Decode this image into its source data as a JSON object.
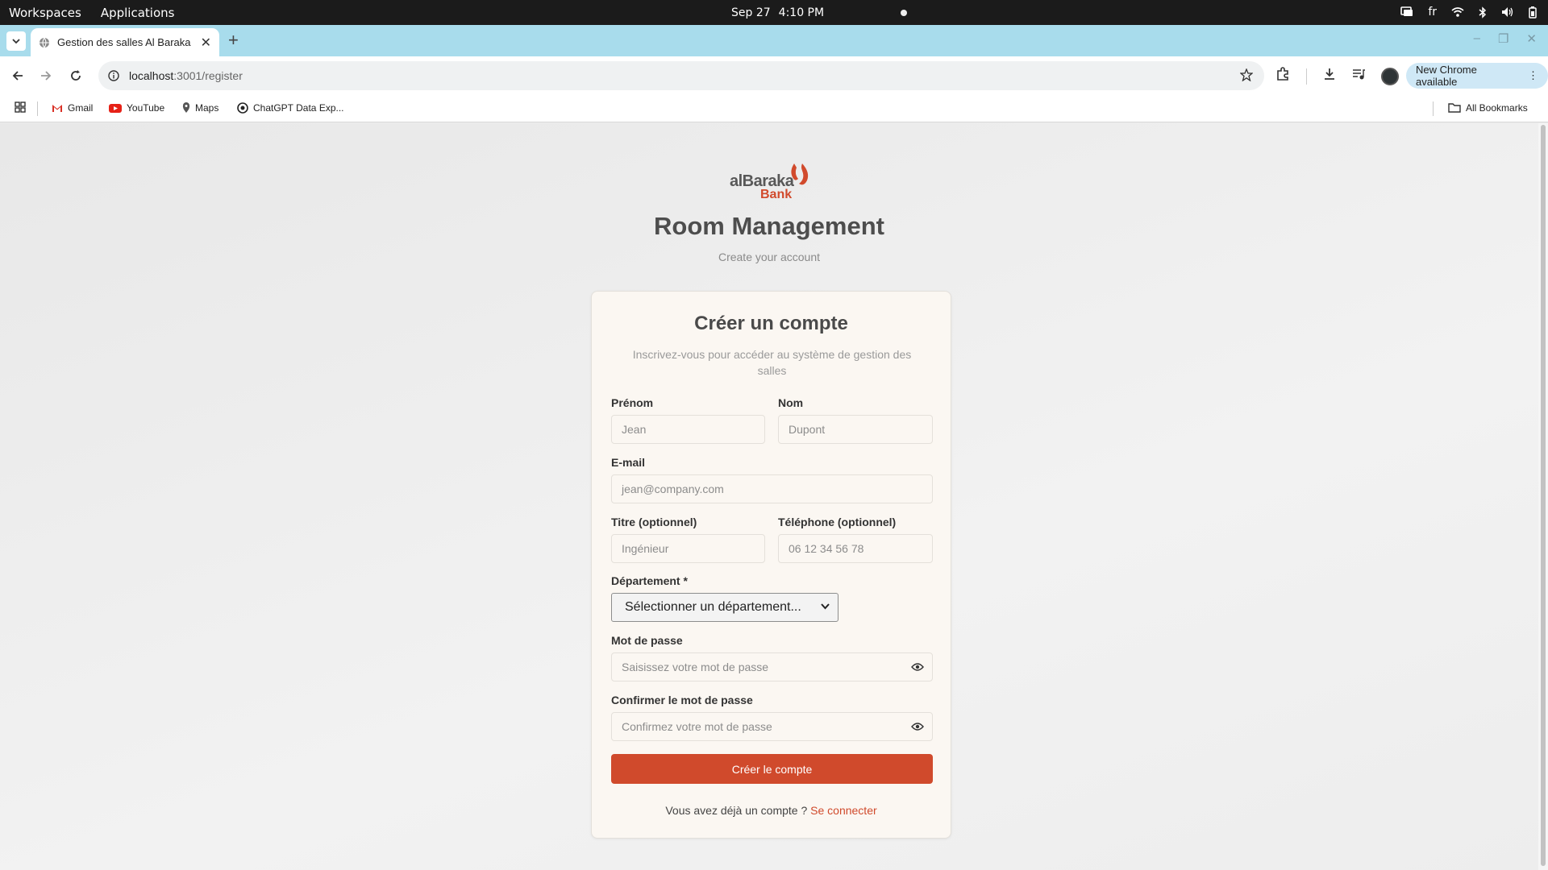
{
  "os": {
    "workspaces": "Workspaces",
    "applications": "Applications",
    "date": "Sep 27",
    "time": "4:10 PM",
    "lang": "fr"
  },
  "browser": {
    "tab_title": "Gestion des salles Al Baraka",
    "url_host": "localhost",
    "url_path": ":3001/register",
    "update_label": "New Chrome available",
    "bookmarks": [
      "Gmail",
      "YouTube",
      "Maps",
      "ChatGPT Data Exp..."
    ],
    "all_bookmarks": "All Bookmarks"
  },
  "brand": {
    "logo_word1": "alBaraka",
    "logo_word2": "Bank",
    "app_title": "Room Management",
    "app_subtitle": "Create your account",
    "accent_color": "#d04a2c"
  },
  "form": {
    "title": "Créer un compte",
    "subtitle": "Inscrivez-vous pour accéder au système de gestion des salles",
    "first_name": {
      "label": "Prénom",
      "placeholder": "Jean"
    },
    "last_name": {
      "label": "Nom",
      "placeholder": "Dupont"
    },
    "email": {
      "label": "E-mail",
      "placeholder": "jean@company.com"
    },
    "job_title": {
      "label": "Titre (optionnel)",
      "placeholder": "Ingénieur"
    },
    "phone": {
      "label": "Téléphone (optionnel)",
      "placeholder": "06 12 34 56 78"
    },
    "department": {
      "label": "Département *",
      "selected": "Sélectionner un département..."
    },
    "password": {
      "label": "Mot de passe",
      "placeholder": "Saisissez votre mot de passe"
    },
    "confirm_password": {
      "label": "Confirmer le mot de passe",
      "placeholder": "Confirmez votre mot de passe"
    },
    "submit_label": "Créer le compte",
    "have_account_text": "Vous avez déjà un compte ?",
    "login_link": "Se connecter"
  }
}
